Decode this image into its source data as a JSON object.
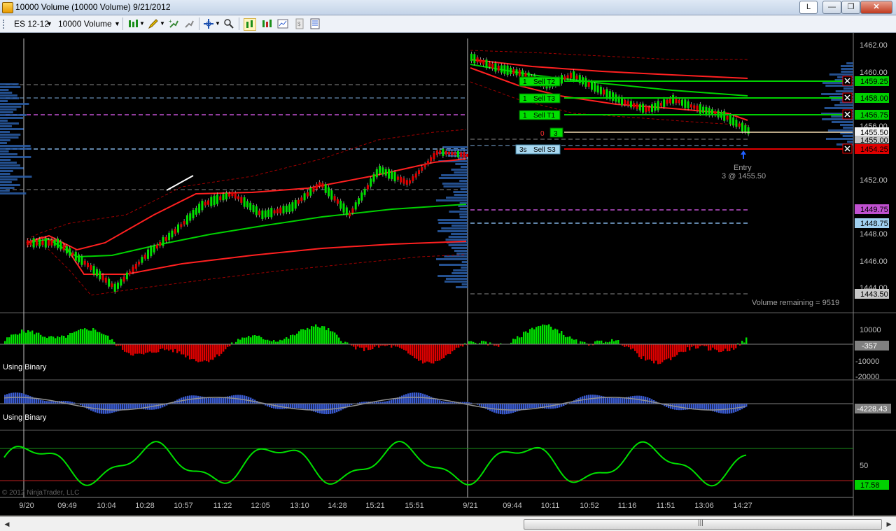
{
  "window": {
    "title": "10000 Volume (10000 Volume)  9/21/2012",
    "btn_min": "L"
  },
  "toolbar": {
    "instrument": "ES 12-12",
    "period": "10000 Volume"
  },
  "price_axis": {
    "ticks": [
      "1462.00",
      "1460.00",
      "1458.00",
      "1456.00",
      "1454.00",
      "1452.00",
      "1450.00",
      "1448.00",
      "1446.00",
      "1444.00"
    ],
    "last_price": "1455.50",
    "price_below": "1455.00",
    "orange_level": "1449.75",
    "blue_level": "1448.75",
    "low_level": "1443.50",
    "target_t2": "1459.25",
    "target_t3": "1458.00",
    "target_t1": "1456.75",
    "stop_s3": "1454.25"
  },
  "orders": {
    "t2": {
      "qty": "1",
      "label": "Sell T2"
    },
    "t3": {
      "qty": "1",
      "label": "Sell T3"
    },
    "t1": {
      "qty": "1",
      "label": "Sell T1"
    },
    "s3": {
      "qty": "3s",
      "label": "Sell S3"
    },
    "position": {
      "pnl": "0",
      "qty": "3"
    }
  },
  "entry": {
    "label": "Entry",
    "detail": "3 @ 1455.50"
  },
  "volume_remaining": "Volume remaining = 9519",
  "panel1": {
    "label": "Using Binary",
    "ticks": [
      "10000",
      "-10000",
      "-20000"
    ],
    "value": "-357"
  },
  "panel2": {
    "label": "Using Binary",
    "value": "-4228.43"
  },
  "panel3": {
    "ticks": [
      "50"
    ],
    "value": "17.58"
  },
  "copyright": "© 2012 NinjaTrader, LLC",
  "time_axis": [
    "9/20",
    "09:49",
    "10:04",
    "10:28",
    "10:57",
    "11:22",
    "12:05",
    "13:10",
    "14:28",
    "15:21",
    "15:51",
    "9/21",
    "09:44",
    "10:11",
    "10:52",
    "11:16",
    "11:51",
    "13:06",
    "14:27"
  ],
  "colors": {
    "bg": "#000000",
    "up": "#00e000",
    "down": "#e00000",
    "ema_red": "#ff2020",
    "ema_green": "#00d000",
    "band": "#a00000",
    "hist_blue": "#3a5bd0"
  }
}
